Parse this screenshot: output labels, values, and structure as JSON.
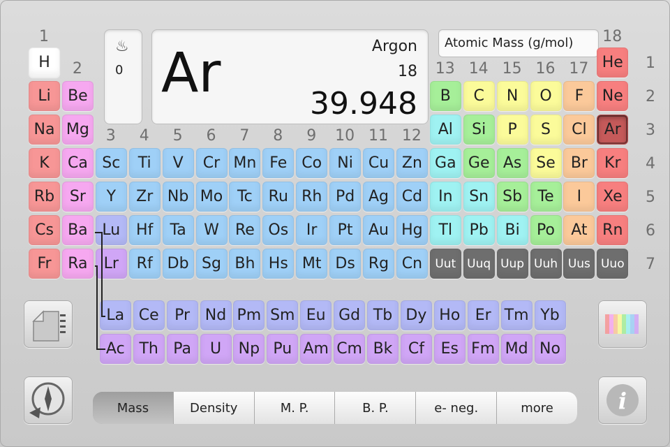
{
  "selected": {
    "symbol": "Ar",
    "name": "Argon",
    "number": "18",
    "mass": "39.948",
    "state_icon": "gas-state-icon",
    "state_glyph": "♨",
    "state_value": "0"
  },
  "property_label": "Atomic Mass (g/mol)",
  "group_labels": [
    "1",
    "2",
    "3",
    "4",
    "5",
    "6",
    "7",
    "8",
    "9",
    "10",
    "11",
    "12",
    "13",
    "14",
    "15",
    "16",
    "17",
    "18"
  ],
  "period_labels": [
    "1",
    "2",
    "3",
    "4",
    "5",
    "6",
    "7"
  ],
  "colors": {
    "alkali": "#f79696",
    "alkaline": "#f6a8f0",
    "transition": "#9fd0f7",
    "post_transition": "#9ff2f2",
    "metalloid": "#a6ef99",
    "nonmetal": "#fbfb9a",
    "halogen": "#fbc99a",
    "noble": "#f77f7f",
    "lanthanide": "#b3b9f6",
    "actinide": "#d0a6f6",
    "unknown": "#6e6e6e",
    "hydrogen": "#ffffff",
    "selected": "#c55a5a"
  },
  "elements": [
    {
      "s": "H",
      "c": "hydrogen",
      "g": 1,
      "p": 1
    },
    {
      "s": "He",
      "c": "noble",
      "g": 18,
      "p": 1
    },
    {
      "s": "Li",
      "c": "alkali",
      "g": 1,
      "p": 2
    },
    {
      "s": "Be",
      "c": "alkaline",
      "g": 2,
      "p": 2
    },
    {
      "s": "B",
      "c": "metalloid",
      "g": 13,
      "p": 2
    },
    {
      "s": "C",
      "c": "nonmetal",
      "g": 14,
      "p": 2
    },
    {
      "s": "N",
      "c": "nonmetal",
      "g": 15,
      "p": 2
    },
    {
      "s": "O",
      "c": "nonmetal",
      "g": 16,
      "p": 2
    },
    {
      "s": "F",
      "c": "halogen",
      "g": 17,
      "p": 2
    },
    {
      "s": "Ne",
      "c": "noble",
      "g": 18,
      "p": 2
    },
    {
      "s": "Na",
      "c": "alkali",
      "g": 1,
      "p": 3
    },
    {
      "s": "Mg",
      "c": "alkaline",
      "g": 2,
      "p": 3
    },
    {
      "s": "Al",
      "c": "post_transition",
      "g": 13,
      "p": 3
    },
    {
      "s": "Si",
      "c": "metalloid",
      "g": 14,
      "p": 3
    },
    {
      "s": "P",
      "c": "nonmetal",
      "g": 15,
      "p": 3
    },
    {
      "s": "S",
      "c": "nonmetal",
      "g": 16,
      "p": 3
    },
    {
      "s": "Cl",
      "c": "halogen",
      "g": 17,
      "p": 3
    },
    {
      "s": "Ar",
      "c": "selected",
      "g": 18,
      "p": 3,
      "sel": true
    },
    {
      "s": "K",
      "c": "alkali",
      "g": 1,
      "p": 4
    },
    {
      "s": "Ca",
      "c": "alkaline",
      "g": 2,
      "p": 4
    },
    {
      "s": "Sc",
      "c": "transition",
      "g": 3,
      "p": 4
    },
    {
      "s": "Ti",
      "c": "transition",
      "g": 4,
      "p": 4
    },
    {
      "s": "V",
      "c": "transition",
      "g": 5,
      "p": 4
    },
    {
      "s": "Cr",
      "c": "transition",
      "g": 6,
      "p": 4
    },
    {
      "s": "Mn",
      "c": "transition",
      "g": 7,
      "p": 4
    },
    {
      "s": "Fe",
      "c": "transition",
      "g": 8,
      "p": 4
    },
    {
      "s": "Co",
      "c": "transition",
      "g": 9,
      "p": 4
    },
    {
      "s": "Ni",
      "c": "transition",
      "g": 10,
      "p": 4
    },
    {
      "s": "Cu",
      "c": "transition",
      "g": 11,
      "p": 4
    },
    {
      "s": "Zn",
      "c": "transition",
      "g": 12,
      "p": 4
    },
    {
      "s": "Ga",
      "c": "post_transition",
      "g": 13,
      "p": 4
    },
    {
      "s": "Ge",
      "c": "metalloid",
      "g": 14,
      "p": 4
    },
    {
      "s": "As",
      "c": "metalloid",
      "g": 15,
      "p": 4
    },
    {
      "s": "Se",
      "c": "nonmetal",
      "g": 16,
      "p": 4
    },
    {
      "s": "Br",
      "c": "halogen",
      "g": 17,
      "p": 4
    },
    {
      "s": "Kr",
      "c": "noble",
      "g": 18,
      "p": 4
    },
    {
      "s": "Rb",
      "c": "alkali",
      "g": 1,
      "p": 5
    },
    {
      "s": "Sr",
      "c": "alkaline",
      "g": 2,
      "p": 5
    },
    {
      "s": "Y",
      "c": "transition",
      "g": 3,
      "p": 5
    },
    {
      "s": "Zr",
      "c": "transition",
      "g": 4,
      "p": 5
    },
    {
      "s": "Nb",
      "c": "transition",
      "g": 5,
      "p": 5
    },
    {
      "s": "Mo",
      "c": "transition",
      "g": 6,
      "p": 5
    },
    {
      "s": "Tc",
      "c": "transition",
      "g": 7,
      "p": 5
    },
    {
      "s": "Ru",
      "c": "transition",
      "g": 8,
      "p": 5
    },
    {
      "s": "Rh",
      "c": "transition",
      "g": 9,
      "p": 5
    },
    {
      "s": "Pd",
      "c": "transition",
      "g": 10,
      "p": 5
    },
    {
      "s": "Ag",
      "c": "transition",
      "g": 11,
      "p": 5
    },
    {
      "s": "Cd",
      "c": "transition",
      "g": 12,
      "p": 5
    },
    {
      "s": "In",
      "c": "post_transition",
      "g": 13,
      "p": 5
    },
    {
      "s": "Sn",
      "c": "post_transition",
      "g": 14,
      "p": 5
    },
    {
      "s": "Sb",
      "c": "metalloid",
      "g": 15,
      "p": 5
    },
    {
      "s": "Te",
      "c": "metalloid",
      "g": 16,
      "p": 5
    },
    {
      "s": "I",
      "c": "halogen",
      "g": 17,
      "p": 5
    },
    {
      "s": "Xe",
      "c": "noble",
      "g": 18,
      "p": 5
    },
    {
      "s": "Cs",
      "c": "alkali",
      "g": 1,
      "p": 6
    },
    {
      "s": "Ba",
      "c": "alkaline",
      "g": 2,
      "p": 6
    },
    {
      "s": "Lu",
      "c": "lanthanide",
      "g": 3,
      "p": 6
    },
    {
      "s": "Hf",
      "c": "transition",
      "g": 4,
      "p": 6
    },
    {
      "s": "Ta",
      "c": "transition",
      "g": 5,
      "p": 6
    },
    {
      "s": "W",
      "c": "transition",
      "g": 6,
      "p": 6
    },
    {
      "s": "Re",
      "c": "transition",
      "g": 7,
      "p": 6
    },
    {
      "s": "Os",
      "c": "transition",
      "g": 8,
      "p": 6
    },
    {
      "s": "Ir",
      "c": "transition",
      "g": 9,
      "p": 6
    },
    {
      "s": "Pt",
      "c": "transition",
      "g": 10,
      "p": 6
    },
    {
      "s": "Au",
      "c": "transition",
      "g": 11,
      "p": 6
    },
    {
      "s": "Hg",
      "c": "transition",
      "g": 12,
      "p": 6
    },
    {
      "s": "Tl",
      "c": "post_transition",
      "g": 13,
      "p": 6
    },
    {
      "s": "Pb",
      "c": "post_transition",
      "g": 14,
      "p": 6
    },
    {
      "s": "Bi",
      "c": "post_transition",
      "g": 15,
      "p": 6
    },
    {
      "s": "Po",
      "c": "metalloid",
      "g": 16,
      "p": 6
    },
    {
      "s": "At",
      "c": "halogen",
      "g": 17,
      "p": 6
    },
    {
      "s": "Rn",
      "c": "noble",
      "g": 18,
      "p": 6
    },
    {
      "s": "Fr",
      "c": "alkali",
      "g": 1,
      "p": 7
    },
    {
      "s": "Ra",
      "c": "alkaline",
      "g": 2,
      "p": 7
    },
    {
      "s": "Lr",
      "c": "actinide",
      "g": 3,
      "p": 7
    },
    {
      "s": "Rf",
      "c": "transition",
      "g": 4,
      "p": 7
    },
    {
      "s": "Db",
      "c": "transition",
      "g": 5,
      "p": 7
    },
    {
      "s": "Sg",
      "c": "transition",
      "g": 6,
      "p": 7
    },
    {
      "s": "Bh",
      "c": "transition",
      "g": 7,
      "p": 7
    },
    {
      "s": "Hs",
      "c": "transition",
      "g": 8,
      "p": 7
    },
    {
      "s": "Mt",
      "c": "transition",
      "g": 9,
      "p": 7
    },
    {
      "s": "Ds",
      "c": "transition",
      "g": 10,
      "p": 7
    },
    {
      "s": "Rg",
      "c": "transition",
      "g": 11,
      "p": 7
    },
    {
      "s": "Cn",
      "c": "transition",
      "g": 12,
      "p": 7
    },
    {
      "s": "Uut",
      "c": "unknown",
      "g": 13,
      "p": 7,
      "small": true
    },
    {
      "s": "Uuq",
      "c": "unknown",
      "g": 14,
      "p": 7,
      "small": true
    },
    {
      "s": "Uup",
      "c": "unknown",
      "g": 15,
      "p": 7,
      "small": true
    },
    {
      "s": "Uuh",
      "c": "unknown",
      "g": 16,
      "p": 7,
      "small": true
    },
    {
      "s": "Uus",
      "c": "unknown",
      "g": 17,
      "p": 7,
      "small": true
    },
    {
      "s": "Uuo",
      "c": "unknown",
      "g": 18,
      "p": 7,
      "small": true
    }
  ],
  "lanthanides": [
    "La",
    "Ce",
    "Pr",
    "Nd",
    "Pm",
    "Sm",
    "Eu",
    "Gd",
    "Tb",
    "Dy",
    "Ho",
    "Er",
    "Tm",
    "Yb"
  ],
  "actinides": [
    "Ac",
    "Th",
    "Pa",
    "U",
    "Np",
    "Pu",
    "Am",
    "Cm",
    "Bk",
    "Cf",
    "Es",
    "Fm",
    "Md",
    "No"
  ],
  "tabs": [
    {
      "label": "Mass",
      "active": true
    },
    {
      "label": "Density"
    },
    {
      "label": "M. P."
    },
    {
      "label": "B. P."
    },
    {
      "label": "e- neg."
    },
    {
      "label": "more"
    }
  ],
  "buttons": {
    "notes": "notes-icon",
    "color_key": "color-spectrum-icon",
    "reset": "compass-reset-icon",
    "info": "info-icon",
    "info_glyph": "i"
  }
}
